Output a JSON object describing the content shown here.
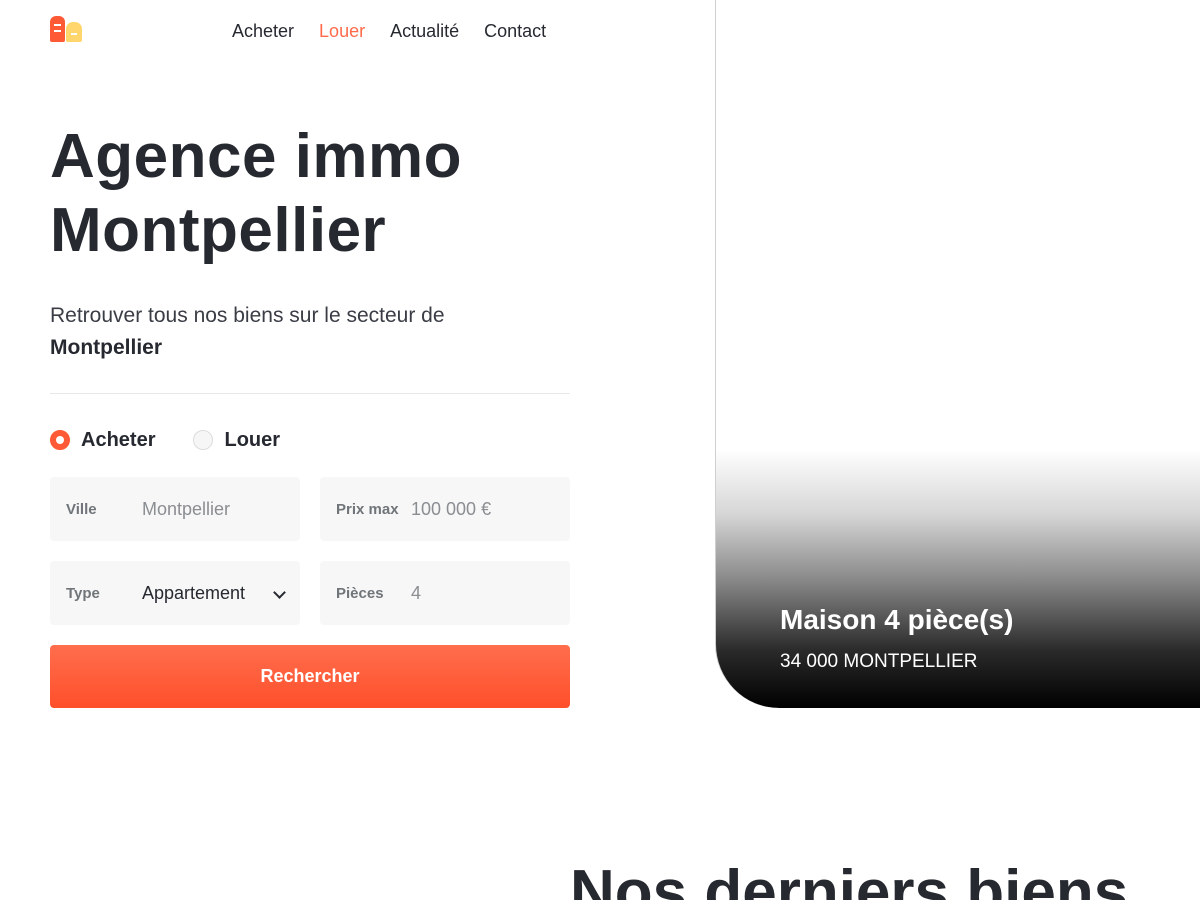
{
  "header": {
    "logo_icon": "house-logo-icon",
    "nav": [
      {
        "label": "Acheter",
        "active": false
      },
      {
        "label": "Louer",
        "active": true
      },
      {
        "label": "Actualité",
        "active": false
      },
      {
        "label": "Contact",
        "active": false
      }
    ]
  },
  "hero": {
    "title_line1": "Agence immo",
    "title_line2": "Montpellier",
    "subtitle": "Retrouver tous nos biens sur le secteur de",
    "subtitle_bold": "Montpellier"
  },
  "search": {
    "radios": [
      {
        "label": "Acheter",
        "checked": true
      },
      {
        "label": "Louer",
        "checked": false
      }
    ],
    "ville": {
      "label": "Ville",
      "value": "Montpellier"
    },
    "prix": {
      "label": "Prix max",
      "value": "100 000 €"
    },
    "type": {
      "label": "Type",
      "value": "Appartement"
    },
    "pieces": {
      "label": "Pièces",
      "value": "4"
    },
    "button_label": "Rechercher"
  },
  "featured": {
    "title": "Maison 4 pièce(s)",
    "location": "34 000 MONTPELLIER"
  },
  "section": {
    "title": "Nos derniers biens"
  },
  "colors": {
    "accent": "#ff5a36",
    "logo_yellow": "#ffd66b",
    "text": "#262930",
    "field_bg": "#f7f7f7"
  }
}
